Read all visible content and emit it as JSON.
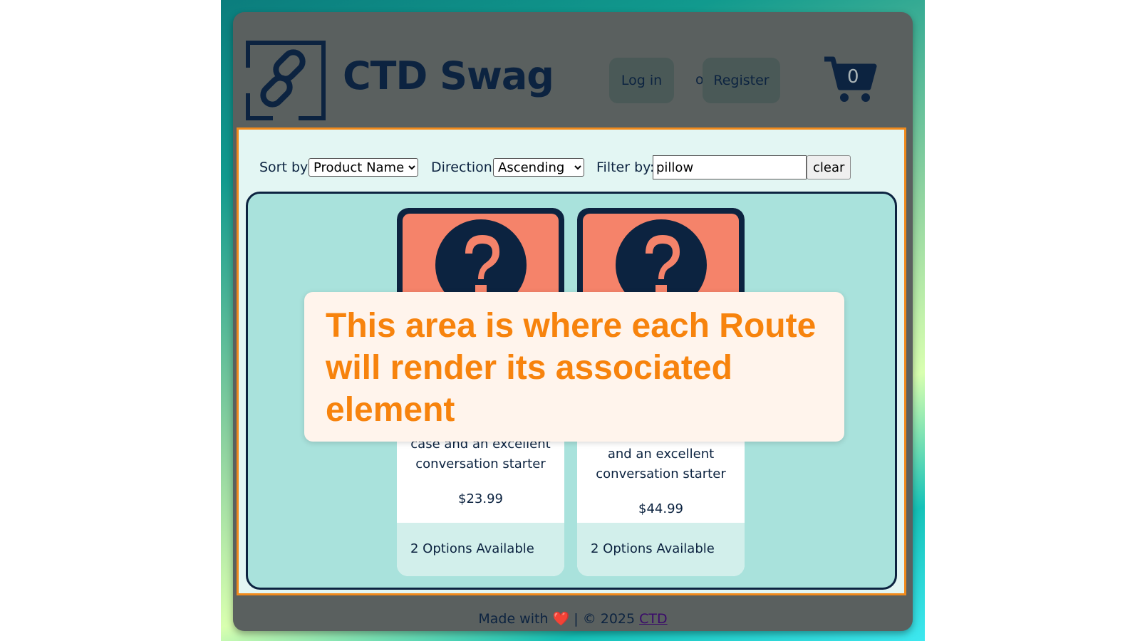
{
  "header": {
    "brand": "CTD Swag",
    "login_label": "Log in",
    "or_label": "or",
    "register_label": "Register",
    "cart_count": "0"
  },
  "toolbar": {
    "sort_label": "Sort by:",
    "sort_value": "Product Name",
    "direction_label": "Direction:",
    "direction_value": "Ascending",
    "filter_label": "Filter by:",
    "filter_value": "pillow",
    "clear_label": "clear"
  },
  "products": [
    {
      "description_visible": "case and an excellent",
      "description_line2": "conversation starter",
      "price": "$23.99",
      "options": "2 Options Available"
    },
    {
      "description_visible": "and an excellent",
      "description_line2": "conversation starter",
      "price": "$44.99",
      "options": "2 Options Available"
    }
  ],
  "overlay": {
    "text": "This area is where each Route will render its associated element"
  },
  "footer": {
    "made_with": "Made with",
    "heart": "❤️",
    "copyright": "| © 2025",
    "link": "CTD"
  },
  "colors": {
    "navy": "#0c2340",
    "accent_orange": "#f7830d",
    "header_bg": "#5a605f",
    "card_image_bg": "#f5836a"
  }
}
